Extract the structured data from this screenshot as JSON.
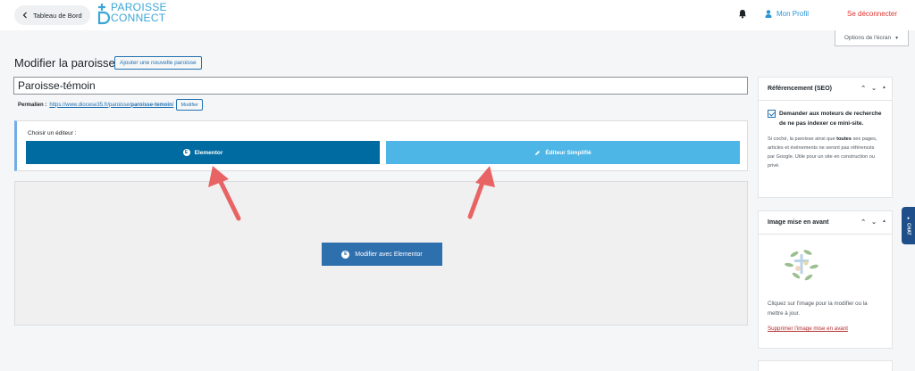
{
  "header": {
    "back_label": "Tableau de Bord",
    "logo_line1": "PAROISSE",
    "logo_line2": "CONNECT",
    "profile_label": "Mon Profil",
    "logout_label": "Se déconnecter"
  },
  "screen_options_label": "Options de l'écran",
  "page": {
    "title": "Modifier la paroisse",
    "add_new_label": "Ajouter une nouvelle paroisse",
    "post_title_value": "Paroisse-témoin"
  },
  "permalink": {
    "label": "Permalien :",
    "url_base": "https://www.diocese35.fr/paroisse/",
    "url_slug": "paroisse-temoin",
    "url_end": "/",
    "edit_label": "Modifier"
  },
  "editor_chooser": {
    "label": "Choisir un éditeur :",
    "elementor_label": "Elementor",
    "simple_label": "Éditeur Simplifié"
  },
  "elementor_area": {
    "button_label": "Modifier avec Elementor"
  },
  "seo_panel": {
    "title": "Référencement (SEO)",
    "checkbox_label": "Demander aux moteurs de recherche de ne pas indexer ce mini-site.",
    "checked": true,
    "help_part1": "Si coché, la paroisse ainsi que ",
    "help_bold": "toutes",
    "help_part2": " ses pages, articles et événements ne seront pas référencés par Google. Utile pour un site en construction ou privé."
  },
  "image_panel": {
    "title": "Image mise en avant",
    "help": "Cliquez sur l'image pour la modifier ou la mettre à jour.",
    "remove_label": "Supprimer l'image mise en avant"
  },
  "chat_label": "CHAT",
  "colors": {
    "elementor_button": "#006ba1",
    "simple_button": "#4eb6e6",
    "annotation_arrow": "#e86464",
    "logout": "#e0322f",
    "brand": "#3aa6d6"
  }
}
